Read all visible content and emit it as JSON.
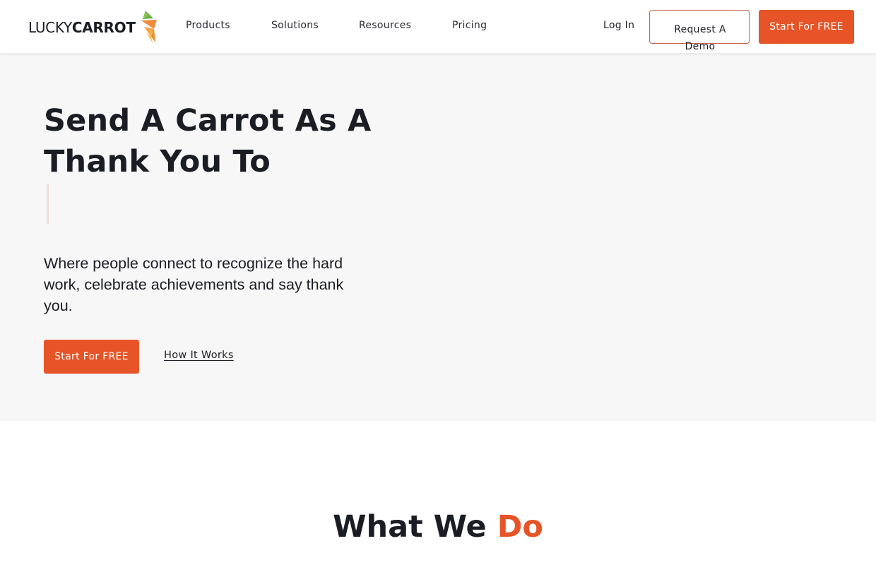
{
  "header": {
    "logo": {
      "text_light": "LUCKY",
      "text_bold": "CARROT",
      "icon": "carrot-icon",
      "colors": {
        "leaf": "#6ab04c",
        "body": "#f08a3c",
        "body_light": "#f6c14b"
      }
    },
    "nav": [
      {
        "label": "Products"
      },
      {
        "label": "Solutions"
      },
      {
        "label": "Resources"
      },
      {
        "label": "Pricing"
      }
    ],
    "login_label": "Log In",
    "demo_label": "Request A Demo",
    "cta_label": "Start For FREE"
  },
  "hero": {
    "title": "Send A Carrot As A Thank You To",
    "typed_text": "",
    "subtitle": "Where people connect to recognize the hard work, celebrate achievements and say thank you.",
    "cta_label": "Start For FREE",
    "secondary_link": "How It Works"
  },
  "section": {
    "title_main": "What We ",
    "title_accent": "Do"
  },
  "colors": {
    "brand_orange": "#e65427",
    "text_dark": "#1b1d24",
    "hero_bg": "#f7f7f7",
    "demo_border": "#c8644a",
    "cursor": "#f3dcd7"
  }
}
